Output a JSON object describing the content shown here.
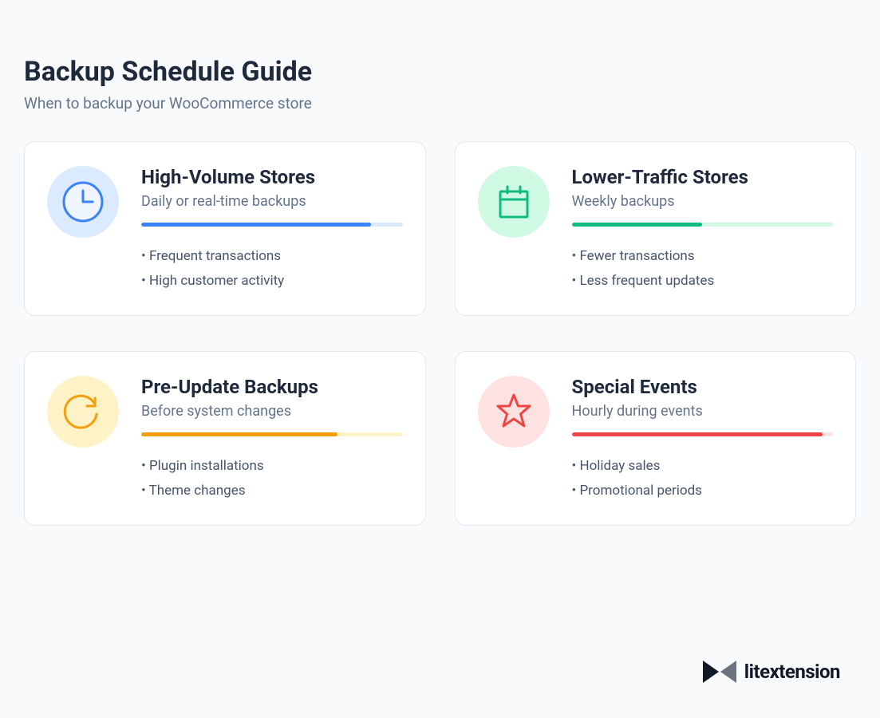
{
  "header": {
    "title": "Backup Schedule Guide",
    "subtitle": "When to backup your WooCommerce store"
  },
  "cards": [
    {
      "icon": "clock-icon",
      "icon_bg": "bg-blue",
      "title": "High-Volume Stores",
      "subtitle": "Daily or real-time backups",
      "progress_track": "track-blue",
      "progress_fill": "fill-blue",
      "progress_pct": 88,
      "bullets": [
        "Frequent transactions",
        "High customer activity"
      ]
    },
    {
      "icon": "calendar-icon",
      "icon_bg": "bg-green",
      "title": "Lower-Traffic Stores",
      "subtitle": "Weekly backups",
      "progress_track": "track-green",
      "progress_fill": "fill-green",
      "progress_pct": 50,
      "bullets": [
        "Fewer transactions",
        "Less frequent updates"
      ]
    },
    {
      "icon": "refresh-icon",
      "icon_bg": "bg-yellow",
      "title": "Pre-Update Backups",
      "subtitle": "Before system changes",
      "progress_track": "track-yellow",
      "progress_fill": "fill-yellow",
      "progress_pct": 75,
      "bullets": [
        "Plugin installations",
        "Theme changes"
      ]
    },
    {
      "icon": "star-icon",
      "icon_bg": "bg-red",
      "title": "Special Events",
      "subtitle": "Hourly during events",
      "progress_track": "track-red",
      "progress_fill": "fill-red",
      "progress_pct": 96,
      "bullets": [
        "Holiday sales",
        "Promotional periods"
      ]
    }
  ],
  "brand": {
    "name": "litextension"
  }
}
